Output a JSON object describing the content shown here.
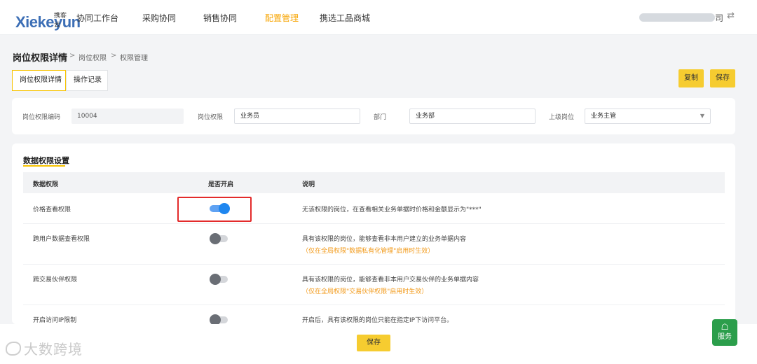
{
  "topnav": {
    "logo_text": "Xiekeyun",
    "logo_sub": "携客云",
    "items": [
      {
        "label": "协同工作台"
      },
      {
        "label": "采购协同"
      },
      {
        "label": "销售协同"
      },
      {
        "label": "配置管理",
        "active": true
      },
      {
        "label": "携选工品商城"
      }
    ],
    "company_suffix": "司",
    "swap_icon": "⇄"
  },
  "breadcrumb": {
    "title": "岗位权限详情",
    "path": [
      "岗位权限",
      "权限管理"
    ],
    "separator": ">"
  },
  "tabs": [
    {
      "label": "岗位权限详情",
      "active": true
    },
    {
      "label": "操作记录"
    }
  ],
  "actions": {
    "copy_label": "复制",
    "save_label": "保存"
  },
  "form": {
    "code_label": "岗位权限编码",
    "code_value": "10004",
    "perm_label": "岗位权限",
    "perm_value": "业务员",
    "dept_label": "部门",
    "dept_value": "业务部",
    "superior_label": "上级岗位",
    "superior_value": "业务主管"
  },
  "data_section": {
    "title": "数据权限设置",
    "headers": [
      "数据权限",
      "是否开启",
      "说明"
    ],
    "rows": [
      {
        "name": "价格查看权限",
        "enabled": true,
        "desc": "无该权限的岗位，在查看相关业务单据时价格和金额显示为\"***\"",
        "note": ""
      },
      {
        "name": "跨用户数据查看权限",
        "enabled": false,
        "desc": "具有该权限的岗位，能够查看非本用户建立的业务单据内容",
        "note": "（仅在全局权限\"数据私有化管理\"启用时生效）"
      },
      {
        "name": "跨交易伙伴权限",
        "enabled": false,
        "desc": "具有该权限的岗位，能够查看非本用户交易伙伴的业务单据内容",
        "note": "（仅在全局权限\"交易伙伴权限\"启用时生效）"
      },
      {
        "name": "开启访问IP限制",
        "enabled": false,
        "desc": "开启后，具有该权限的岗位只能在指定IP下访问平台。",
        "note": ""
      }
    ]
  },
  "footer": {
    "save_label": "保存",
    "watermark": "大数跨境",
    "service_label": "服务",
    "service_icon": "☖"
  },
  "colors": {
    "accent": "#f6cc30",
    "brand": "#3d6fb6",
    "switch_on": "#1f86ef",
    "note": "#f29a1a",
    "highlight": "#e32b2b",
    "service": "#2b9e4b"
  }
}
